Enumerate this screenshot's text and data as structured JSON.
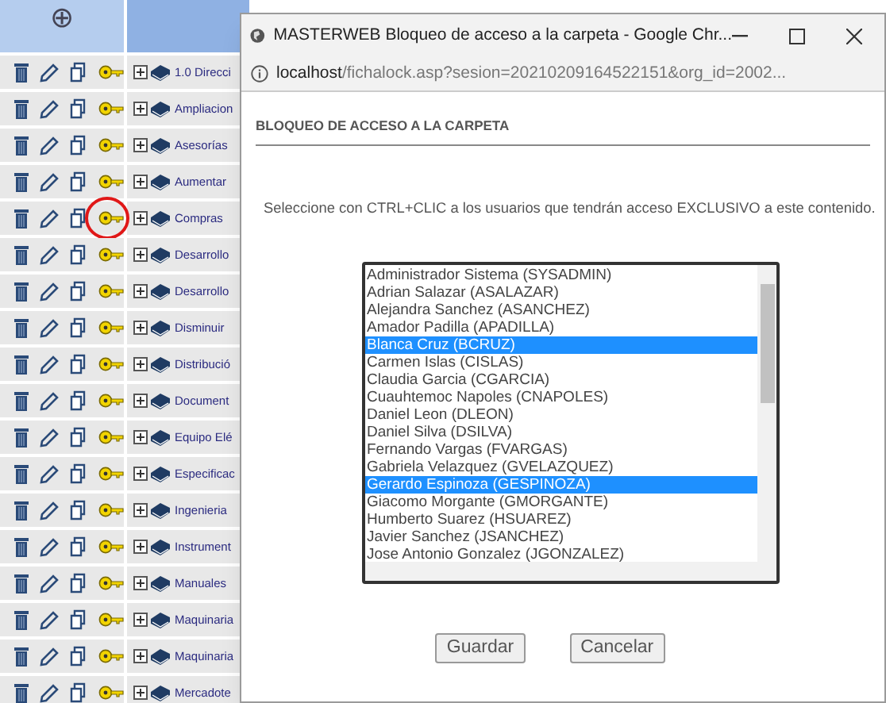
{
  "folder_table": {
    "header_add_symbol": "⊕",
    "rows": [
      {
        "name": "1.0 Direcci",
        "highlighted": false
      },
      {
        "name": "Ampliacion",
        "highlighted": false
      },
      {
        "name": "Asesorías",
        "highlighted": false
      },
      {
        "name": "Aumentar",
        "highlighted": false
      },
      {
        "name": "Compras",
        "highlighted": true
      },
      {
        "name": "Desarrollo",
        "highlighted": false
      },
      {
        "name": "Desarrollo",
        "highlighted": false
      },
      {
        "name": "Disminuir",
        "highlighted": false
      },
      {
        "name": "Distribució",
        "highlighted": false
      },
      {
        "name": "Document",
        "highlighted": false
      },
      {
        "name": "Equipo Elé",
        "highlighted": false
      },
      {
        "name": "Especificac",
        "highlighted": false
      },
      {
        "name": "Ingenieria",
        "highlighted": false
      },
      {
        "name": "Instrument",
        "highlighted": false
      },
      {
        "name": "Manuales",
        "highlighted": false
      },
      {
        "name": "Maquinaria",
        "highlighted": false
      },
      {
        "name": "Maquinaria",
        "highlighted": false
      },
      {
        "name": "Mercadote",
        "highlighted": false
      }
    ]
  },
  "popup": {
    "title": "MASTERWEB Bloqueo de acceso a la carpeta - Google Chr...",
    "url_host": "localhost",
    "url_path": "/fichalock.asp?sesion=20210209164522151&org_id=2002...",
    "heading": "BLOQUEO DE ACCESO A LA CARPETA",
    "instruction": "Seleccione con CTRL+CLIC a los usuarios que tendrán acceso EXCLUSIVO a este contenido.",
    "users": [
      {
        "label": "Administrador Sistema (SYSADMIN)",
        "selected": false
      },
      {
        "label": "Adrian Salazar (ASALAZAR)",
        "selected": false
      },
      {
        "label": "Alejandra Sanchez (ASANCHEZ)",
        "selected": false
      },
      {
        "label": "Amador Padilla (APADILLA)",
        "selected": false
      },
      {
        "label": "Blanca Cruz (BCRUZ)",
        "selected": true
      },
      {
        "label": "Carmen Islas (CISLAS)",
        "selected": false
      },
      {
        "label": "Claudia Garcia (CGARCIA)",
        "selected": false
      },
      {
        "label": "Cuauhtemoc Napoles (CNAPOLES)",
        "selected": false
      },
      {
        "label": "Daniel Leon (DLEON)",
        "selected": false
      },
      {
        "label": "Daniel Silva (DSILVA)",
        "selected": false
      },
      {
        "label": "Fernando Vargas (FVARGAS)",
        "selected": false
      },
      {
        "label": "Gabriela Velazquez (GVELAZQUEZ)",
        "selected": false
      },
      {
        "label": "Gerardo Espinoza (GESPINOZA)",
        "selected": true
      },
      {
        "label": "Giacomo Morgante (GMORGANTE)",
        "selected": false
      },
      {
        "label": "Humberto Suarez (HSUAREZ)",
        "selected": false
      },
      {
        "label": "Javier Sanchez (JSANCHEZ)",
        "selected": false
      },
      {
        "label": "Jose Antonio Gonzalez (JGONZALEZ)",
        "selected": false
      }
    ],
    "buttons": [
      "Guardar",
      "Cancelar"
    ]
  }
}
